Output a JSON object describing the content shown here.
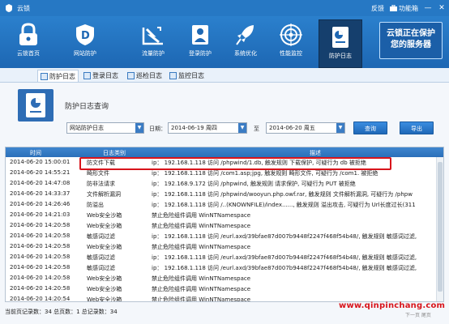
{
  "window": {
    "title": "云锁",
    "feedback": "反馈",
    "features": "功能箱",
    "minimize": "—",
    "close": "✕"
  },
  "toolbar": {
    "items": [
      {
        "label": "云锁首页"
      },
      {
        "label": "网站防护"
      },
      {
        "label": "流量防护"
      },
      {
        "label": "登录防护"
      },
      {
        "label": "系统优化"
      },
      {
        "label": "性能监控"
      },
      {
        "label": "防护日志"
      }
    ],
    "promo_line1": "云锁正在保护",
    "promo_line2": "您的服务器"
  },
  "tabs": [
    {
      "label": "防护日志"
    },
    {
      "label": "登录日志"
    },
    {
      "label": "巡检日志"
    },
    {
      "label": "监控日志"
    }
  ],
  "page": {
    "title": "防护日志查询",
    "type_select": "网站防护日志",
    "date_label": "日期：",
    "date_from": "2014-06-19 周四",
    "to_label": "至",
    "date_to": "2014-06-20 周五",
    "query_button": "查询",
    "export_button": "导出"
  },
  "table": {
    "headers": {
      "time": "时间",
      "type": "日志类别",
      "desc": "描述"
    },
    "rows": [
      {
        "time": "2014-06-20 15:00:01",
        "type": "防文件下载",
        "desc": "ip： 192.168.1.118 访问 /phpwind/1.db, 触发规则 下载保护, 可疑行为 db 被拒绝"
      },
      {
        "time": "2014-06-20 14:55:21",
        "type": "畸形文件",
        "desc": "ip： 192.168.1.118 访问 /com1.asp;jpg, 触发规则 畸形文件, 可疑行为 /com1. 被拒绝"
      },
      {
        "time": "2014-06-20 14:47:08",
        "type": "防非法请求",
        "desc": "ip： 192.168.9.172 访问 /phpwind, 触发规则 请求保护, 可疑行为 PUT 被拒绝"
      },
      {
        "time": "2014-06-20 14:33:37",
        "type": "文件解析漏洞",
        "desc": "ip： 192.168.1.118 访问 /phpwind/wooyun.php.owf.rar, 触发规则 文件解析漏洞, 可疑行为 /phpw"
      },
      {
        "time": "2014-06-20 14:26:46",
        "type": "防溢出",
        "desc": "ip： 192.168.1.118 访问 /..(KNOWNFILE)/index......, 触发规则 溢出攻击, 可疑行为 Url长度过长(311"
      },
      {
        "time": "2014-06-20 14:21:03",
        "type": "Web安全沙箱",
        "desc": "禁止危险组件调用 WinNTNamespace"
      },
      {
        "time": "2014-06-20 14:20:58",
        "type": "Web安全沙箱",
        "desc": "禁止危险组件调用 WinNTNamespace"
      },
      {
        "time": "2014-06-20 14:20:58",
        "type": "敏感词过滤",
        "desc": "ip： 192.168.1.118 访问 /eurl.axd/39bfae87d007b9448f2247f468f54b48/, 触发规则 敏感词过滤,"
      },
      {
        "time": "2014-06-20 14:20:58",
        "type": "Web安全沙箱",
        "desc": "禁止危险组件调用 WinNTNamespace"
      },
      {
        "time": "2014-06-20 14:20:58",
        "type": "敏感词过滤",
        "desc": "ip： 192.168.1.118 访问 /eurl.axd/39bfae87d007b9448f2247f468f54b48/, 触发规则 敏感词过滤,"
      },
      {
        "time": "2014-06-20 14:20:58",
        "type": "敏感词过滤",
        "desc": "ip： 192.168.1.118 访问 /eurl.axd/39bfae87d007b9448f2247f468f54b48/, 触发规则 敏感词过滤,"
      },
      {
        "time": "2014-06-20 14:20:58",
        "type": "Web安全沙箱",
        "desc": "禁止危险组件调用 WinNTNamespace"
      },
      {
        "time": "2014-06-20 14:20:58",
        "type": "Web安全沙箱",
        "desc": "禁止危险组件调用 WinNTNamespace"
      },
      {
        "time": "2014-06-20 14:20:54",
        "type": "Web安全沙箱",
        "desc": "禁止危险组件调用 WinNTNamespace"
      }
    ]
  },
  "status": {
    "text": "当前页记录数：34  总页数：1  总记录数：34"
  },
  "watermark": "www.qinpinchang.com",
  "pager": "下一页  尾页"
}
